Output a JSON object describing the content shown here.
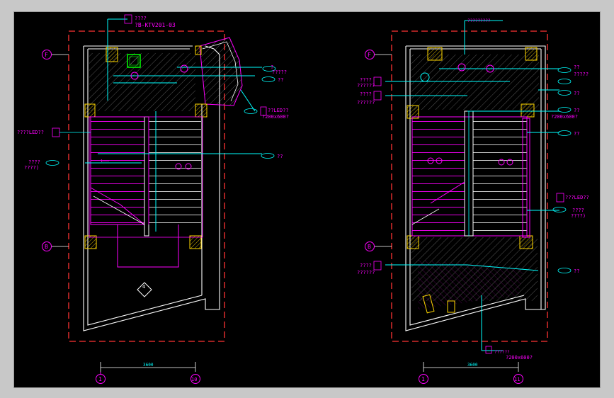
{
  "colors": {
    "background": "#000000",
    "wall": "#ffffff",
    "dimension_red": "#ff3333",
    "annotation_magenta": "#ff00ff",
    "leader_cyan": "#00ffff",
    "hatch_green": "#00ff00",
    "column_yellow": "#ffd700"
  },
  "left_plan": {
    "grid_f": "F",
    "grid_b": "B",
    "grid_1": "1",
    "grid_10": "10",
    "dim_width": "3600",
    "title_tag": "????",
    "title_code": "?B-KTV201-03",
    "tag_r1": "?",
    "tag_r1b": "?????",
    "tag_r2": "??",
    "tag_r3_a": "??LED??",
    "tag_r3_b": "?200x600?",
    "tag_l1": "????LED??",
    "tag_r4": "??",
    "tag_l2_a": "????",
    "tag_l2_b": "????)",
    "stair_mark": "1———",
    "symbol": "4"
  },
  "right_plan": {
    "grid_f": "F",
    "grid_b": "B",
    "grid_1": "1",
    "grid_11": "11",
    "dim_width": "3600",
    "top_note": "?????????",
    "tag_l1_a": "????",
    "tag_l1_b": "??????",
    "tag_l2_a": "????",
    "tag_l2_b": "??????",
    "tag_r1": "??",
    "tag_r1b": "?????",
    "tag_r2": "??",
    "tag_r3": "??",
    "tag_r3b": "?200x600?",
    "tag_r4": "??",
    "tag_r5_a": "???LED??",
    "tag_r5_b": "????",
    "tag_r5_c": "????)",
    "tag_r6": "??",
    "tag_l3_a": "????",
    "tag_l3_b": "??????",
    "bottom_a": "??????",
    "bottom_b": "?200x600?"
  }
}
